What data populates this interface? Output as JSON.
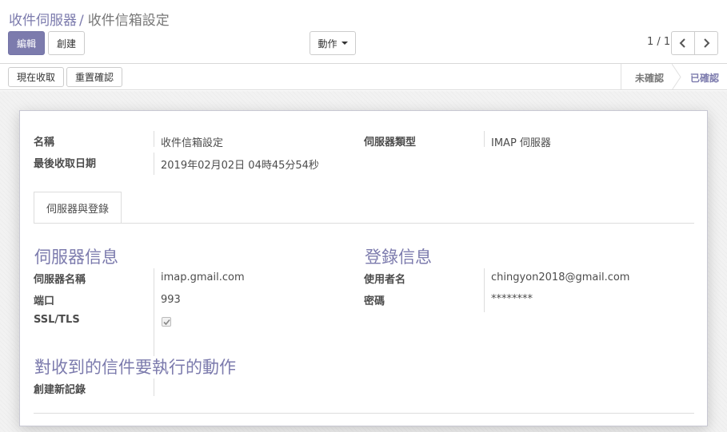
{
  "breadcrumb": {
    "parent": "收件伺服器",
    "separator": "/",
    "current": "收件信箱設定"
  },
  "toolbar": {
    "edit_label": "編輯",
    "create_label": "創建",
    "action_label": "動作"
  },
  "pager": {
    "value": "1 / 1"
  },
  "statusbar": {
    "fetch_now_label": "現在收取",
    "reset_confirm_label": "重置確認",
    "stages": [
      {
        "label": "未確認",
        "active": false
      },
      {
        "label": "已確認",
        "active": true
      }
    ]
  },
  "form": {
    "name_label": "名稱",
    "name_value": "收件信箱設定",
    "last_fetch_label": "最後收取日期",
    "last_fetch_value": "2019年02月02日 04時45分54秒",
    "server_type_label": "伺服器類型",
    "server_type_value": "IMAP 伺服器",
    "tabs": [
      {
        "label": "伺服器與登錄"
      }
    ],
    "server_info": {
      "title": "伺服器信息",
      "server_name_label": "伺服器名稱",
      "server_name_value": "imap.gmail.com",
      "port_label": "端口",
      "port_value": "993",
      "ssl_label": "SSL/TLS",
      "ssl_checked": true
    },
    "login_info": {
      "title": "登錄信息",
      "username_label": "使用者名",
      "username_value": "chingyon2018@gmail.com",
      "password_label": "密碼",
      "password_value": "********"
    },
    "actions": {
      "title": "對收到的信件要執行的動作",
      "create_record_label": "創建新記錄",
      "create_record_value": ""
    }
  },
  "colors": {
    "primary": "#7c7bad",
    "text": "#4c4c4c",
    "muted": "#777777"
  }
}
